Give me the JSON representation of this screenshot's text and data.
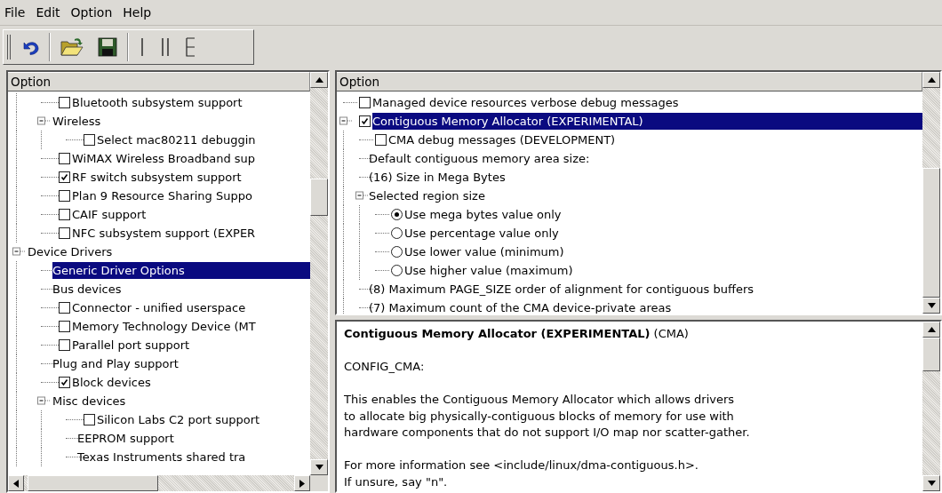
{
  "menu": [
    {
      "label": "File"
    },
    {
      "label": "Edit"
    },
    {
      "label": "Option"
    },
    {
      "label": "Help"
    }
  ],
  "left_tree": {
    "column": "Option",
    "scrolled_children": [
      {
        "kind": "check",
        "label": "Bluetooth subsystem support",
        "checked": false,
        "selected": false
      },
      {
        "kind": "plain",
        "label": "Wireless",
        "expanded": true,
        "selected": false,
        "children": [
          {
            "kind": "check",
            "label": "Select mac80211 debuggin",
            "checked": false,
            "selected": false
          }
        ]
      },
      {
        "kind": "check",
        "label": "WiMAX Wireless Broadband sup",
        "checked": false,
        "selected": false
      },
      {
        "kind": "check",
        "label": "RF switch subsystem support",
        "checked": true,
        "selected": false
      },
      {
        "kind": "check",
        "label": "Plan 9 Resource Sharing Suppo",
        "checked": false,
        "selected": false
      },
      {
        "kind": "check",
        "label": "CAIF support",
        "checked": false,
        "selected": false
      },
      {
        "kind": "check",
        "label": "NFC subsystem support (EXPER",
        "checked": false,
        "selected": false
      }
    ],
    "items": [
      {
        "kind": "plain",
        "label": "Device Drivers",
        "expanded": true,
        "selected": false,
        "children": [
          {
            "kind": "plain",
            "label": "Generic Driver Options",
            "selected": true
          },
          {
            "kind": "plain",
            "label": "Bus devices",
            "selected": false
          },
          {
            "kind": "check",
            "label": "Connector - unified userspace",
            "checked": false,
            "selected": false
          },
          {
            "kind": "check",
            "label": "Memory Technology Device (MT",
            "checked": false,
            "selected": false
          },
          {
            "kind": "check",
            "label": "Parallel port support",
            "checked": false,
            "selected": false
          },
          {
            "kind": "plain",
            "label": "Plug and Play support",
            "selected": false
          },
          {
            "kind": "check",
            "label": "Block devices",
            "checked": true,
            "selected": false
          },
          {
            "kind": "plain",
            "label": "Misc devices",
            "expanded": true,
            "selected": false,
            "children": [
              {
                "kind": "check",
                "label": "Silicon Labs C2 port support",
                "checked": false,
                "selected": false
              },
              {
                "kind": "plain",
                "label": "EEPROM support",
                "selected": false
              },
              {
                "kind": "plain",
                "label": "Texas Instruments shared tra",
                "selected": false
              }
            ]
          }
        ]
      }
    ]
  },
  "right_tree": {
    "column": "Option",
    "items": [
      {
        "kind": "check",
        "label": "Managed device resources verbose debug messages",
        "checked": false,
        "selected": false
      },
      {
        "kind": "check",
        "label": "Contiguous Memory Allocator (EXPERIMENTAL)",
        "checked": true,
        "expanded": true,
        "selected": true,
        "children": [
          {
            "kind": "check",
            "label": "CMA debug messages (DEVELOPMENT)",
            "checked": false,
            "selected": false
          },
          {
            "kind": "plain",
            "label": "Default contiguous memory area size:",
            "selected": false
          },
          {
            "kind": "plain",
            "label": "(16) Size in Mega Bytes",
            "selected": false
          },
          {
            "kind": "plain",
            "label": "Selected region size",
            "expanded": true,
            "selected": false,
            "children": [
              {
                "kind": "radio",
                "label": "Use mega bytes value only",
                "checked": true,
                "selected": false
              },
              {
                "kind": "radio",
                "label": "Use percentage value only",
                "checked": false,
                "selected": false
              },
              {
                "kind": "radio",
                "label": "Use lower value (minimum)",
                "checked": false,
                "selected": false
              },
              {
                "kind": "radio",
                "label": "Use higher value (maximum)",
                "checked": false,
                "selected": false
              }
            ]
          },
          {
            "kind": "plain",
            "label": "(8) Maximum PAGE_SIZE order of alignment for contiguous buffers",
            "selected": false
          },
          {
            "kind": "plain",
            "label": "(7) Maximum count of the CMA device-private areas",
            "selected": false
          }
        ]
      }
    ]
  },
  "help": {
    "title": "**Contiguous Memory Allocator (EXPERIMENTAL)** (CMA)",
    "paragraphs": [
      "CONFIG_CMA:",
      "This enables the Contiguous Memory Allocator which allows drivers\nto allocate big physically-contiguous blocks of memory for use with\nhardware components that do not support I/O map nor scatter-gather.",
      "For more information see <include/linux/dma-contiguous.h>.\nIf unsure, say \"n\"."
    ]
  }
}
